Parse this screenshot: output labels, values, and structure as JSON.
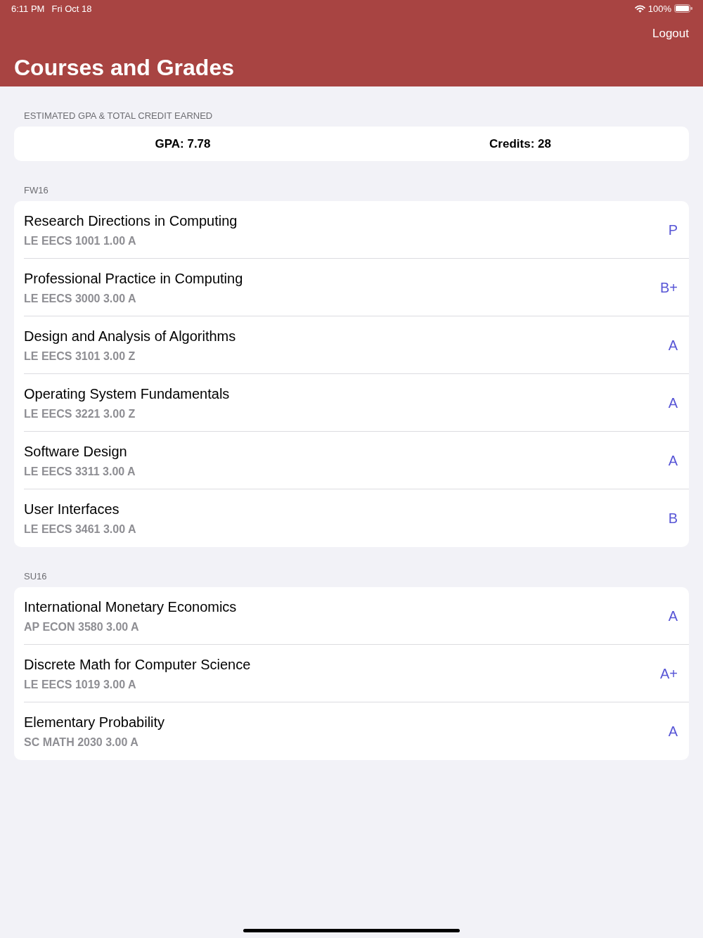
{
  "status_bar": {
    "time": "6:11 PM",
    "date": "Fri Oct 18",
    "battery": "100%"
  },
  "nav": {
    "action": "Logout",
    "title": "Courses and Grades"
  },
  "summary": {
    "header": "ESTIMATED GPA & TOTAL CREDIT EARNED",
    "gpa": "GPA: 7.78",
    "credits": "Credits: 28"
  },
  "terms": [
    {
      "header": "FW16",
      "courses": [
        {
          "title": "Research Directions in Computing",
          "code": "LE EECS 1001 1.00 A",
          "grade": "P"
        },
        {
          "title": "Professional Practice in Computing",
          "code": "LE EECS 3000 3.00 A",
          "grade": "B+"
        },
        {
          "title": "Design and Analysis of Algorithms",
          "code": "LE EECS 3101 3.00 Z",
          "grade": "A"
        },
        {
          "title": "Operating System Fundamentals",
          "code": "LE EECS 3221 3.00 Z",
          "grade": "A"
        },
        {
          "title": "Software Design",
          "code": "LE EECS 3311 3.00 A",
          "grade": "A"
        },
        {
          "title": "User Interfaces",
          "code": "LE EECS 3461 3.00 A",
          "grade": "B"
        }
      ]
    },
    {
      "header": "SU16",
      "courses": [
        {
          "title": "International Monetary Economics",
          "code": "AP ECON 3580 3.00 A",
          "grade": "A"
        },
        {
          "title": "Discrete Math for Computer Science",
          "code": "LE EECS 1019 3.00 A",
          "grade": "A+"
        },
        {
          "title": "Elementary Probability",
          "code": "SC MATH 2030 3.00 A",
          "grade": "A"
        }
      ]
    }
  ]
}
